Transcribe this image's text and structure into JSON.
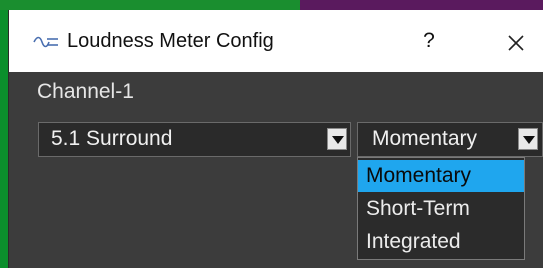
{
  "window": {
    "title": "Loudness Meter Config",
    "help_label": "?",
    "close_label": "✕"
  },
  "channel": {
    "label": "Channel-1"
  },
  "layout_combo": {
    "value": "5.1 Surround"
  },
  "mode_combo": {
    "value": "Momentary",
    "options": [
      "Momentary",
      "Short-Term",
      "Integrated"
    ],
    "selected_index": 0
  },
  "colors": {
    "background_app": "#0b8f2c",
    "dialog_body": "#3c3c3c",
    "selection_highlight": "#1fa6ee"
  },
  "icons": {
    "app_icon": "waveform-icon",
    "dropdown_arrow": "chevron-down-icon"
  }
}
